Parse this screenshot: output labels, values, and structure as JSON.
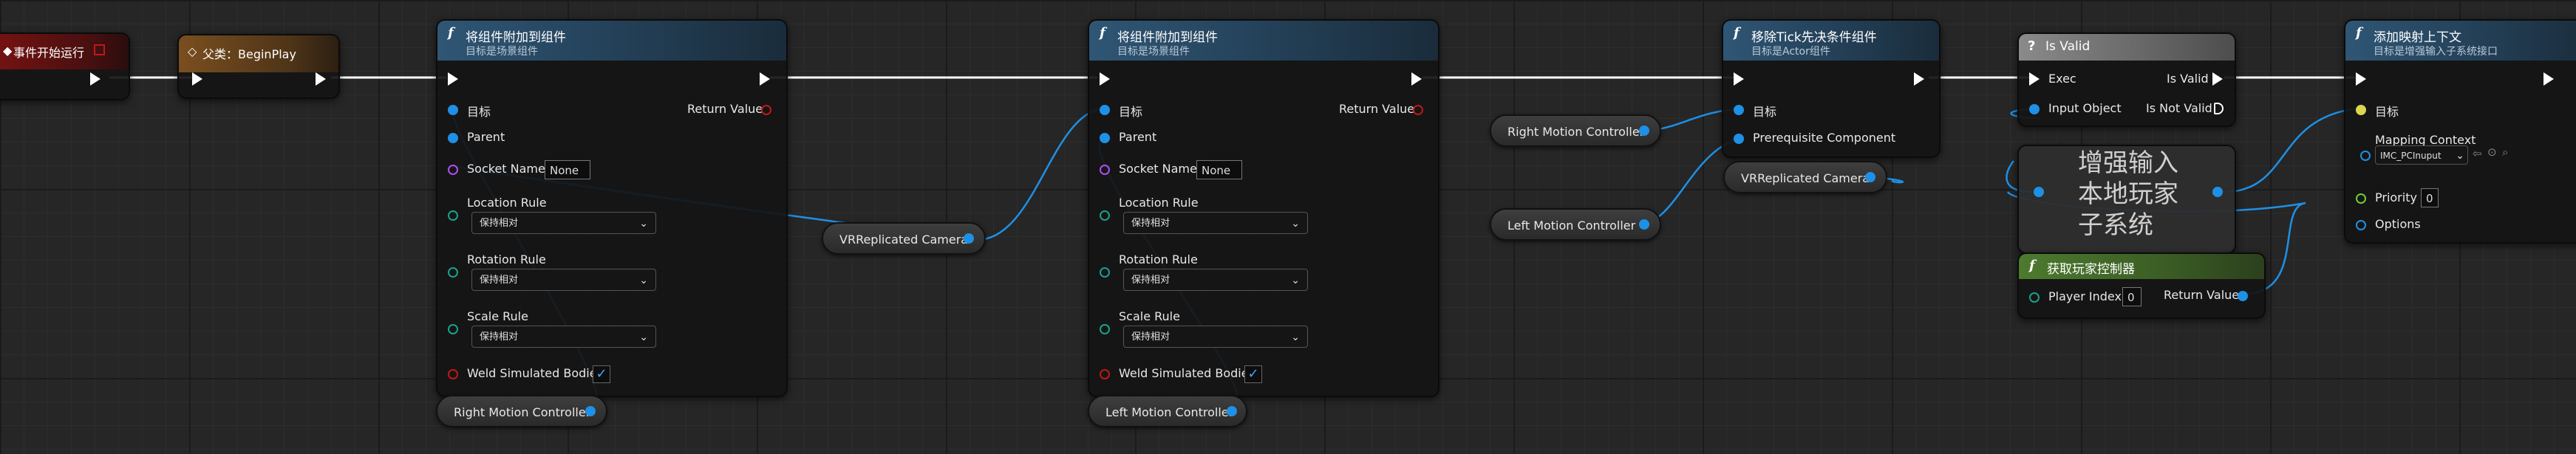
{
  "begin_node": {
    "title": "事件开始运行"
  },
  "parent_node": {
    "title": "父类：BeginPlay"
  },
  "attach1": {
    "title": "将组件附加到组件",
    "subtitle": "目标是场景组件",
    "pin_target": "目标",
    "pin_parent": "Parent",
    "pin_socket": "Socket Name",
    "socket_value": "None",
    "pin_return": "Return Value",
    "loc_rule": "Location Rule",
    "loc_value": "保持相对",
    "rot_rule": "Rotation Rule",
    "rot_value": "保持相对",
    "scale_rule": "Scale Rule",
    "scale_value": "保持相对",
    "weld": "Weld Simulated Bodies"
  },
  "attach2": {
    "title": "将组件附加到组件",
    "subtitle": "目标是场景组件",
    "pin_target": "目标",
    "pin_parent": "Parent",
    "pin_socket": "Socket Name",
    "socket_value": "None",
    "pin_return": "Return Value",
    "loc_rule": "Location Rule",
    "loc_value": "保持相对",
    "rot_rule": "Rotation Rule",
    "rot_value": "保持相对",
    "scale_rule": "Scale Rule",
    "scale_value": "保持相对",
    "weld": "Weld Simulated Bodies"
  },
  "remove_tick": {
    "title": "移除Tick先决条件组件",
    "subtitle": "目标是Actor组件",
    "pin_target": "目标",
    "pin_prereq": "Prerequisite Component"
  },
  "is_valid": {
    "title": "Is Valid",
    "exec": "Exec",
    "input_object": "Input Object",
    "is_valid": "Is Valid",
    "is_not_valid": "Is Not Valid"
  },
  "enhanced_input": {
    "line1": "增强输入",
    "line2": "本地玩家",
    "line3": "子系统"
  },
  "get_pc": {
    "title": "获取玩家控制器",
    "player_index": "Player Index",
    "player_index_value": "0",
    "return_value": "Return Value"
  },
  "add_mapping": {
    "title": "添加映射上下文",
    "subtitle": "目标是增强输入子系统接口",
    "pin_target": "目标",
    "mapping_context": "Mapping Context",
    "mapping_value": "IMC_PCInuput",
    "priority": "Priority",
    "priority_value": "0",
    "options": "Options"
  },
  "vars": {
    "vr_camera_1": "VRReplicated Camera",
    "right_mc_1": "Right Motion Controller",
    "left_mc_1": "Left Motion Controller",
    "right_mc_2": "Right Motion Controller",
    "left_mc_2": "Left Motion Controller",
    "vr_camera_2": "VRReplicated Camera"
  },
  "colors": {
    "object_pin": "#1e90e6",
    "exec_wire": "#ffffff",
    "name_pin": "#b24cf0",
    "bool_pin": "#c01818",
    "struct_pin": "#1aa08e"
  }
}
